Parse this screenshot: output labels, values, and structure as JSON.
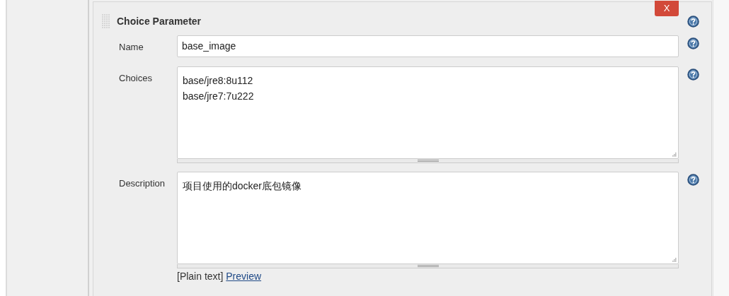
{
  "section": {
    "title": "Choice Parameter",
    "delete_button": "X"
  },
  "fields": [
    {
      "kind": "input",
      "label": "Name",
      "value": "base_image"
    },
    {
      "kind": "textarea",
      "label": "Choices",
      "lines": [
        "base/jre8:8u112",
        "base/jre7:7u222"
      ]
    },
    {
      "kind": "textarea",
      "label": "Description",
      "lines": [
        "项目使用的docker底包镜像"
      ],
      "format_note": "[Plain text]",
      "preview_link": "Preview"
    }
  ]
}
